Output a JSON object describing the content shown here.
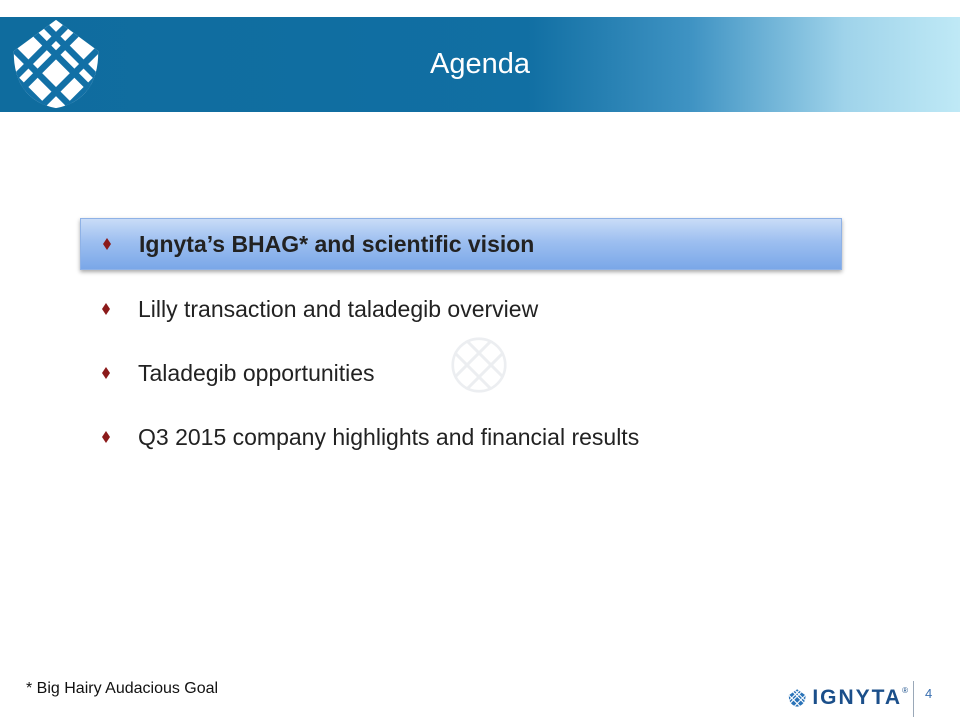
{
  "slide": {
    "title": "Agenda",
    "agenda_items": [
      {
        "label": "Ignyta’s BHAG* and scientific vision",
        "highlighted": true
      },
      {
        "label": "Lilly transaction and taladegib overview",
        "highlighted": false
      },
      {
        "label": "Taladegib opportunities",
        "highlighted": false
      },
      {
        "label": "Q3 2015 company highlights and financial results",
        "highlighted": false
      }
    ],
    "footnote": "* Big Hairy Audacious Goal",
    "brand": {
      "name": "IGNYTA",
      "registered": "®"
    },
    "page_number": "4"
  },
  "colors": {
    "header": "#116fa3",
    "bullet": "#8b1a1a",
    "highlight": "#9dbff0",
    "brand": "#1b4f8a"
  },
  "icons": {
    "header_logo": "ignyta-lattice-logo-icon",
    "bullet": "diamond-bullet-icon",
    "watermark": "ignyta-watermark-icon"
  }
}
